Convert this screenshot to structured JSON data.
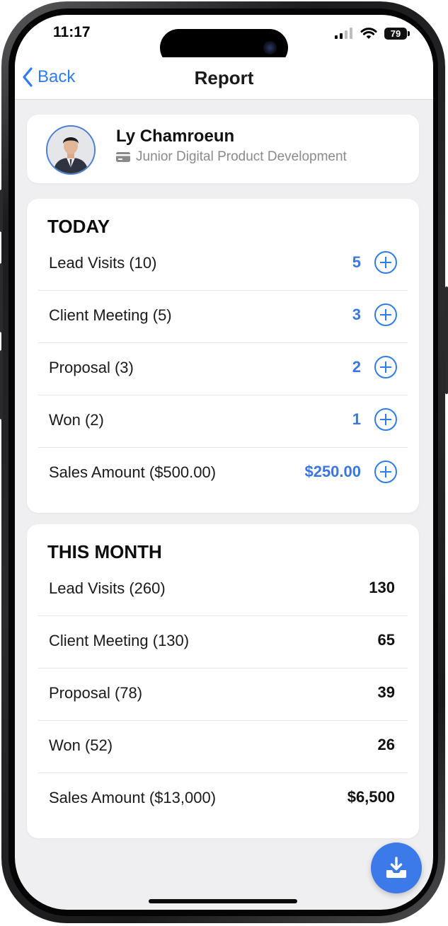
{
  "status_bar": {
    "time": "11:17",
    "battery": "79"
  },
  "nav": {
    "back_label": "Back",
    "title": "Report"
  },
  "profile": {
    "name": "Ly Chamroeun",
    "role": "Junior Digital Product Development"
  },
  "today": {
    "title": "TODAY",
    "rows": [
      {
        "label": "Lead Visits (10)",
        "value": "5"
      },
      {
        "label": "Client Meeting (5)",
        "value": "3"
      },
      {
        "label": "Proposal (3)",
        "value": "2"
      },
      {
        "label": "Won (2)",
        "value": "1"
      },
      {
        "label": "Sales Amount ($500.00)",
        "value": "$250.00"
      }
    ]
  },
  "month": {
    "title": "THIS MONTH",
    "rows": [
      {
        "label": "Lead Visits (260)",
        "value": "130"
      },
      {
        "label": "Client Meeting (130)",
        "value": "65"
      },
      {
        "label": "Proposal (78)",
        "value": "39"
      },
      {
        "label": "Won (52)",
        "value": "26"
      },
      {
        "label": "Sales Amount ($13,000)",
        "value": "$6,500"
      }
    ]
  },
  "colors": {
    "accent": "#2f7bf0",
    "fab": "#3b7ae8",
    "background": "#efeff1"
  }
}
